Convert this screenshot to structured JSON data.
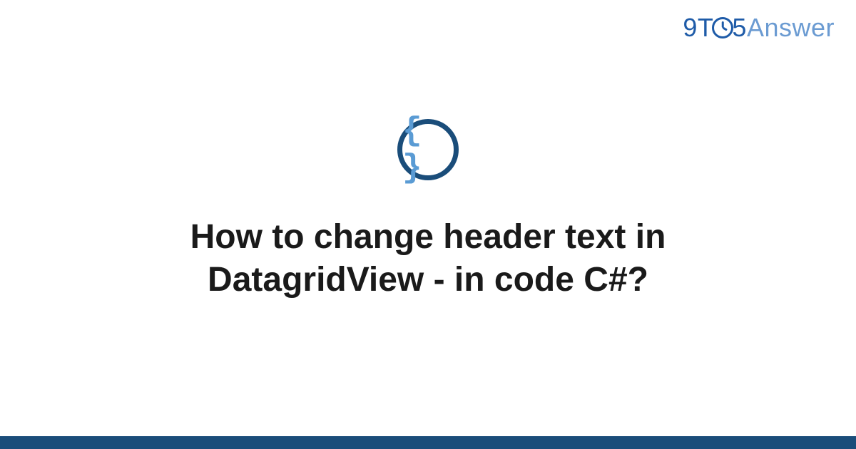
{
  "brand": {
    "part1": "9",
    "part2": "T",
    "part3": "5",
    "part4": "Answer"
  },
  "icon": {
    "glyph": "{ }",
    "name": "code-braces"
  },
  "title": "How to change header text in DatagridView - in code C#?",
  "colors": {
    "accent_dark": "#1a4d7a",
    "accent_light": "#5a9bd4",
    "brand_blue": "#1e5ba8",
    "brand_light": "#6b9bd2"
  }
}
